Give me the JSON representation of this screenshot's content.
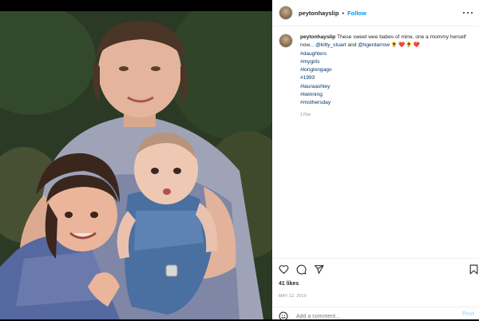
{
  "post": {
    "username": "peytonhayslip",
    "separator": "•",
    "follow_label": "Follow",
    "more_icon": "more-horizontal-icon"
  },
  "caption": {
    "username": "peytonhayslip",
    "text": "These sweet wee babes of mine, one a mommy herself now...",
    "mention1": "@kitty_stuart",
    "and_word": "and",
    "mention2": "@tigerdarrow",
    "emojis": "🌻❤️🌻❤️",
    "hashtags": [
      "#daughters",
      "#mygirls",
      "#longlongago",
      "#1993",
      "#lauraashley",
      "#twinning",
      "#mothersday"
    ],
    "time": "170w"
  },
  "actions": {
    "icons": [
      "heart-icon",
      "comment-icon",
      "share-icon",
      "bookmark-icon"
    ],
    "likes": "41 likes",
    "date": "MAY 12, 2019"
  },
  "comment": {
    "placeholder": "Add a comment...",
    "post_label": "Post"
  },
  "colors": {
    "link": "#00376b",
    "follow": "#0095f6",
    "muted": "#8e8e8e"
  }
}
